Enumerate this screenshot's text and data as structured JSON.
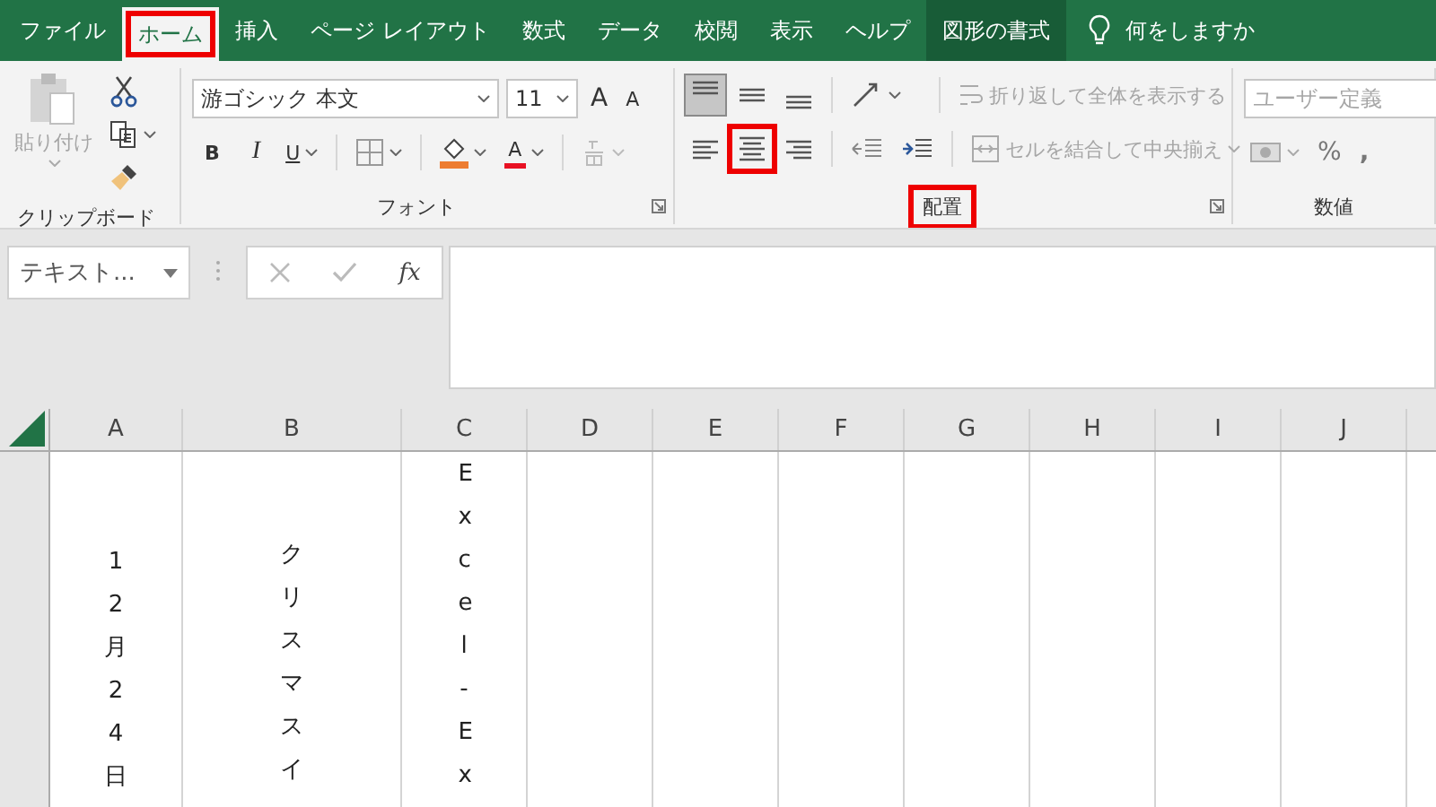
{
  "tabs": [
    {
      "label": "ファイル",
      "selected": false,
      "kind": "normal",
      "annotated": false
    },
    {
      "label": "ホーム",
      "selected": true,
      "kind": "normal",
      "annotated": true
    },
    {
      "label": "挿入",
      "selected": false,
      "kind": "normal",
      "annotated": false
    },
    {
      "label": "ページ レイアウト",
      "selected": false,
      "kind": "normal",
      "annotated": false
    },
    {
      "label": "数式",
      "selected": false,
      "kind": "normal",
      "annotated": false
    },
    {
      "label": "データ",
      "selected": false,
      "kind": "normal",
      "annotated": false
    },
    {
      "label": "校閲",
      "selected": false,
      "kind": "normal",
      "annotated": false
    },
    {
      "label": "表示",
      "selected": false,
      "kind": "normal",
      "annotated": false
    },
    {
      "label": "ヘルプ",
      "selected": false,
      "kind": "normal",
      "annotated": false
    },
    {
      "label": "図形の書式",
      "selected": false,
      "kind": "contextual",
      "annotated": false
    }
  ],
  "tell_me": {
    "label": "何をしますか"
  },
  "ribbon": {
    "clipboard": {
      "paste_label": "貼り付け",
      "paste_disabled": true,
      "label": "クリップボード"
    },
    "font": {
      "font_name": "游ゴシック 本文",
      "font_size": "11",
      "grow_label": "A",
      "shrink_label": "A",
      "bold_label": "B",
      "italic_label": "I",
      "underline_label": "U",
      "font_color_label": "A",
      "label": "フォント"
    },
    "alignment": {
      "buttons": [
        {
          "kind": "top",
          "selected": true,
          "annotated": false
        },
        {
          "kind": "middle",
          "selected": false,
          "annotated": false
        },
        {
          "kind": "bottom",
          "selected": false,
          "annotated": false
        },
        {
          "kind": "left",
          "selected": false,
          "annotated": false
        },
        {
          "kind": "center",
          "selected": false,
          "annotated": true
        },
        {
          "kind": "right",
          "selected": false,
          "annotated": false
        }
      ],
      "wrap_label": "折り返して全体を表示する",
      "wrap_disabled": true,
      "merge_label": "セルを結合して中央揃え",
      "merge_disabled": true,
      "label": "配置",
      "label_annotated": true
    },
    "number": {
      "format": "ユーザー定義",
      "format_disabled": true,
      "percent_label": "%",
      "comma_label": ",",
      "label": "数値"
    }
  },
  "formula_bar": {
    "name_box": "テキスト...",
    "fx_label": "fx"
  },
  "sheet": {
    "columns": [
      "A",
      "B",
      "C",
      "D",
      "E",
      "F",
      "G",
      "H",
      "I",
      "J"
    ],
    "rows": [
      {
        "cells": [
          {
            "text": "12月24日"
          },
          {
            "text": "クリスマスイ"
          },
          {
            "text": "Excel-Ex"
          }
        ]
      }
    ]
  }
}
